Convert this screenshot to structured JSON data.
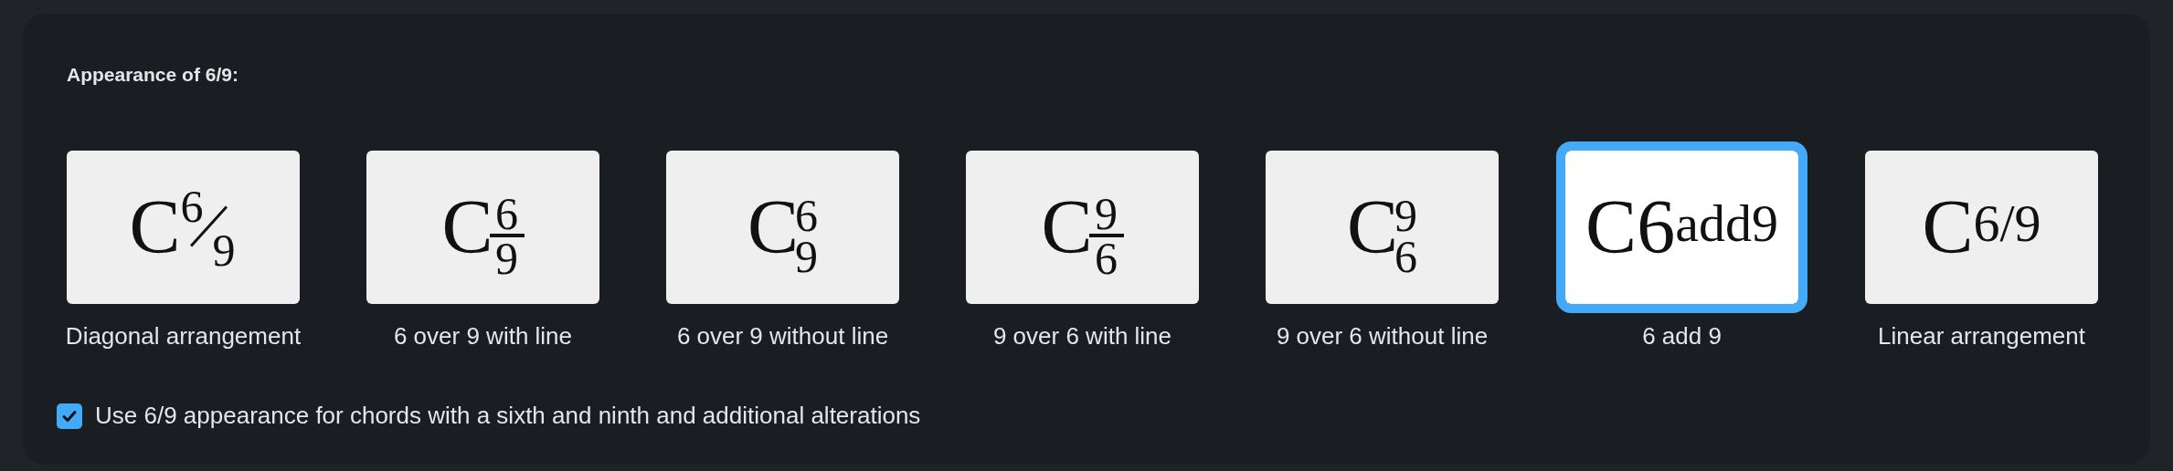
{
  "heading": "Appearance of 6/9:",
  "options": [
    {
      "kind": "diagonal",
      "root": "C",
      "upper": "6",
      "lower": "9",
      "label": "Diagonal arrangement",
      "selected": false
    },
    {
      "kind": "stack-line",
      "root": "C",
      "upper": "6",
      "lower": "9",
      "label": "6 over 9 with line",
      "selected": false
    },
    {
      "kind": "stack",
      "root": "C",
      "upper": "6",
      "lower": "9",
      "label": "6 over 9 without line",
      "selected": false
    },
    {
      "kind": "stack-line",
      "root": "C",
      "upper": "9",
      "lower": "6",
      "label": "9 over 6 with line",
      "selected": false
    },
    {
      "kind": "stack",
      "root": "C",
      "upper": "9",
      "lower": "6",
      "label": "9 over 6 without line",
      "selected": false
    },
    {
      "kind": "inline-super",
      "root": "C",
      "main": "6",
      "super": "add9",
      "label": "6 add 9",
      "selected": true
    },
    {
      "kind": "super",
      "root": "C",
      "super": "6/9",
      "label": "Linear arrangement",
      "selected": false
    }
  ],
  "checkbox": {
    "label": "Use 6/9 appearance for chords with a sixth and ninth and additional alterations",
    "checked": true
  }
}
